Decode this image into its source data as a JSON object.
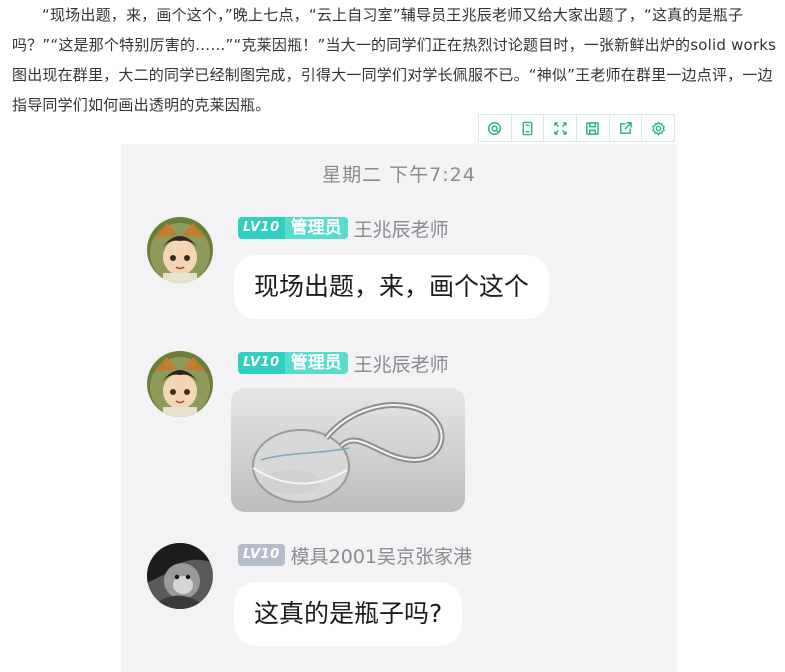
{
  "article": {
    "text": "“现场出题，来，画个这个，”晚上七点，“云上自习室”辅导员王兆辰老师又给大家出题了，“这真的是瓶子吗？”“这是那个特别厉害的……”“克莱因瓶！”当大一的同学们正在热烈讨论题目时，一张新鲜出炉的solid works图出现在群里，大二的同学已经制图完成，引得大一同学们对学长佩服不已。“神似”王老师在群里一边点评，一边指导同学们如何画出透明的克莱因瓶。"
  },
  "toolbar": {
    "icons": [
      "search-circle-icon",
      "copy-icon",
      "fullscreen-icon",
      "save-icon",
      "share-icon",
      "settings-icon"
    ],
    "accent": "#21b77e"
  },
  "chat": {
    "timestamp": "星期二 下午7:24",
    "messages": [
      {
        "level": "LV10",
        "role": "管理员",
        "sender": "王兆辰老师",
        "text": "现场出题，来，画个这个"
      },
      {
        "level": "LV10",
        "role": "管理员",
        "sender": "王兆辰老师",
        "image": "klein-bottle-render"
      },
      {
        "level": "LV10",
        "sender": "模具2001吴京张家港",
        "text": "这真的是瓶子吗?"
      }
    ],
    "colors": {
      "level_admin": "#2fd0c0",
      "role_badge": "#57dccd",
      "level_member": "#b7bccd",
      "background": "#f3f3f5"
    }
  }
}
